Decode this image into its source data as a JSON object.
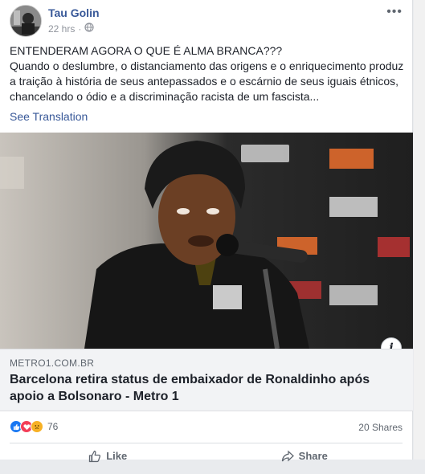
{
  "post": {
    "author": "Tau Golin",
    "timestamp": "22 hrs",
    "privacy_icon": "globe-icon",
    "more_label": "•••",
    "text_line1": "ENTENDERAM AGORA O QUE É ALMA BRANCA???",
    "text_body": "Quando o deslumbre, o distanciamento das origens e o enriquecimento produz a traição à história de seus antepassados e o escárnio de seus iguais étnicos, chancelando o ódio e a discriminação racista de um fascista...",
    "see_translation": "See Translation"
  },
  "link": {
    "domain": "METRO1.COM.BR",
    "headline": "Barcelona retira status de embaixador de Ronaldinho após apoio a Bolsonaro - Metro 1",
    "info_label": "i"
  },
  "stats": {
    "reaction_icons": [
      "like-icon",
      "love-icon",
      "sad-icon"
    ],
    "reaction_count": "76",
    "shares": "20 Shares"
  },
  "actions": {
    "like": "Like",
    "share": "Share"
  },
  "colors": {
    "link_blue": "#385898",
    "like_blue": "#1877f2",
    "love_red": "#f33e58",
    "sad_yellow": "#f7b125"
  }
}
